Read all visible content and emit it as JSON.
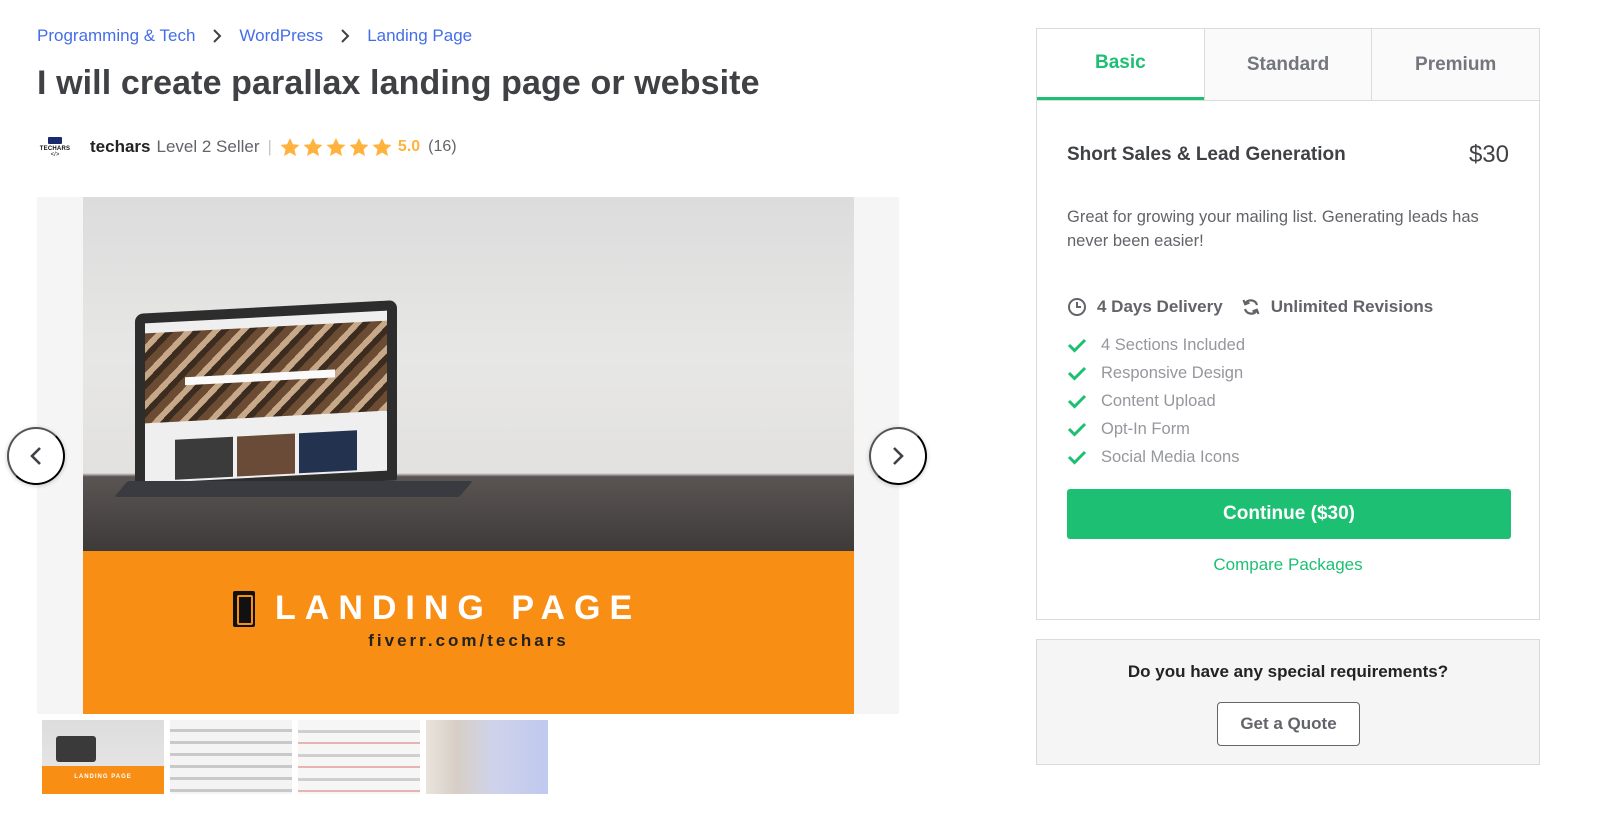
{
  "breadcrumb": [
    {
      "label": "Programming & Tech"
    },
    {
      "label": "WordPress"
    },
    {
      "label": "Landing Page"
    }
  ],
  "gig": {
    "title": "I will create parallax landing page or website"
  },
  "seller": {
    "avatar_brand": "TECHARS",
    "avatar_code": "</>",
    "name": "techars",
    "level": "Level 2 Seller",
    "divider": "|",
    "stars": 5,
    "rating": "5.0",
    "review_count": "(16)"
  },
  "gallery": {
    "banner_title": "LANDING PAGE",
    "banner_url": "fiverr.com/techars",
    "thumb_caption": "LANDING PAGE",
    "thumbnail_count": 4,
    "prev_icon": "chevron-left-icon",
    "next_icon": "chevron-right-icon"
  },
  "package": {
    "tabs": [
      {
        "label": "Basic",
        "active": true
      },
      {
        "label": "Standard",
        "active": false
      },
      {
        "label": "Premium",
        "active": false
      }
    ],
    "name": "Short Sales & Lead Generation",
    "price": "$30",
    "description": "Great for growing your mailing list. Generating leads has never been easier!",
    "delivery": "4 Days Delivery",
    "revisions": "Unlimited Revisions",
    "features": [
      "4 Sections Included",
      "Responsive Design",
      "Content Upload",
      "Opt-In Form",
      "Social Media Icons"
    ],
    "continue_label": "Continue ($30)",
    "compare_label": "Compare Packages"
  },
  "requirements": {
    "question": "Do you have any special requirements?",
    "quote_label": "Get a Quote"
  },
  "colors": {
    "accent_green": "#1dbf73",
    "link_blue": "#446ee7",
    "star_gold": "#ffb33e",
    "banner_orange": "#f88e14"
  }
}
